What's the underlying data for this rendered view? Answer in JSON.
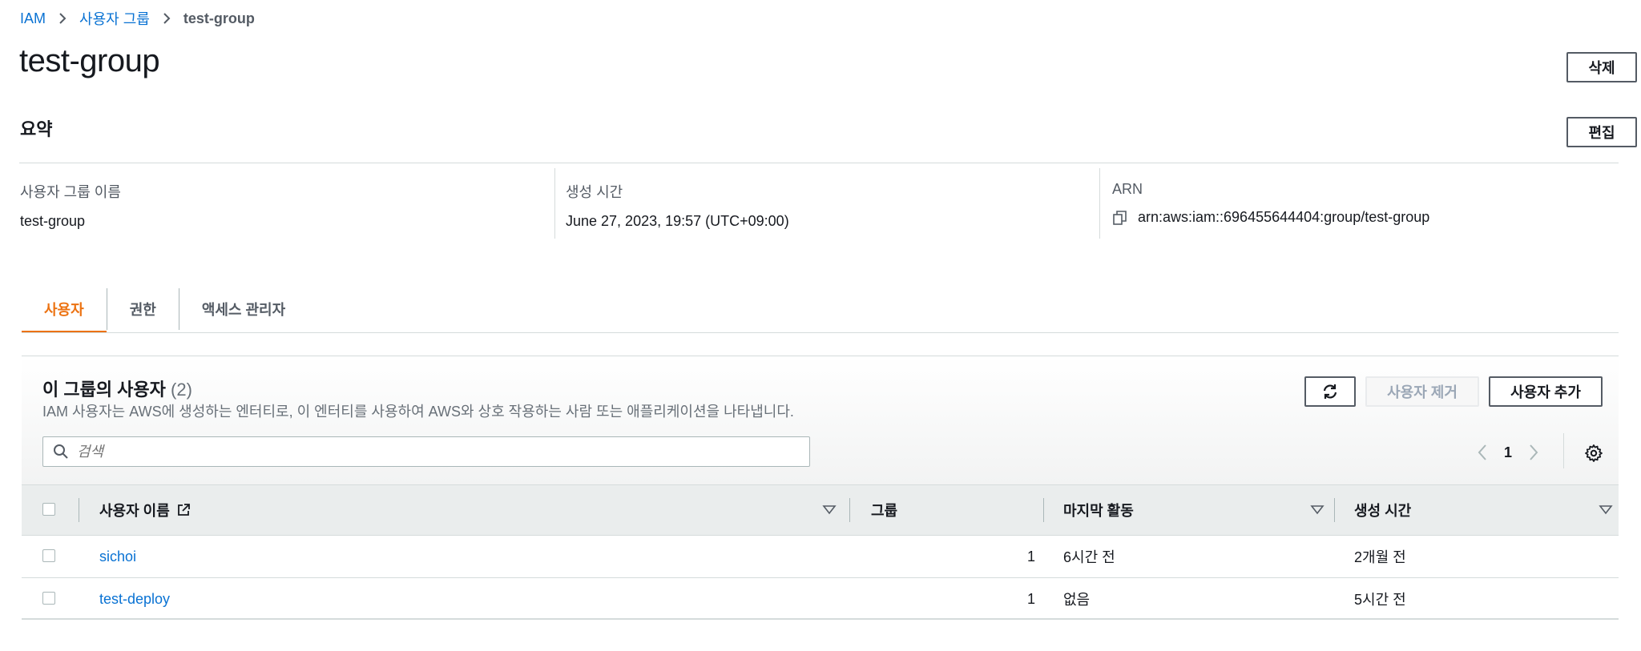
{
  "breadcrumb": {
    "items": [
      "IAM",
      "사용자 그룹"
    ],
    "current": "test-group"
  },
  "page": {
    "title": "test-group",
    "delete_label": "삭제"
  },
  "summary": {
    "title": "요약",
    "edit_label": "편집",
    "fields": [
      {
        "label": "사용자 그룹 이름",
        "value": "test-group"
      },
      {
        "label": "생성 시간",
        "value": "June 27, 2023, 19:57 (UTC+09:00)"
      },
      {
        "label": "ARN",
        "value": "arn:aws:iam::696455644404:group/test-group"
      }
    ]
  },
  "tabs": [
    {
      "label": "사용자",
      "active": true
    },
    {
      "label": "권한",
      "active": false
    },
    {
      "label": "액세스 관리자",
      "active": false
    }
  ],
  "users_panel": {
    "title": "이 그룹의 사용자",
    "count": "(2)",
    "description": "IAM 사용자는 AWS에 생성하는 엔터티로, 이 엔터티를 사용하여 AWS와 상호 작용하는 사람 또는 애플리케이션을 나타냅니다.",
    "search_placeholder": "검색",
    "remove_label": "사용자 제거",
    "add_label": "사용자 추가",
    "page_number": "1",
    "columns": [
      "사용자 이름",
      "그룹",
      "마지막 활동",
      "생성 시간"
    ],
    "rows": [
      {
        "name": "sichoi",
        "groups": "1",
        "last_activity": "6시간 전",
        "created": "2개월 전"
      },
      {
        "name": "test-deploy",
        "groups": "1",
        "last_activity": "없음",
        "created": "5시간 전"
      }
    ]
  },
  "colors": {
    "link": "#0972d3",
    "accent": "#ec7211",
    "text": "#16191f",
    "muted": "#687078"
  }
}
